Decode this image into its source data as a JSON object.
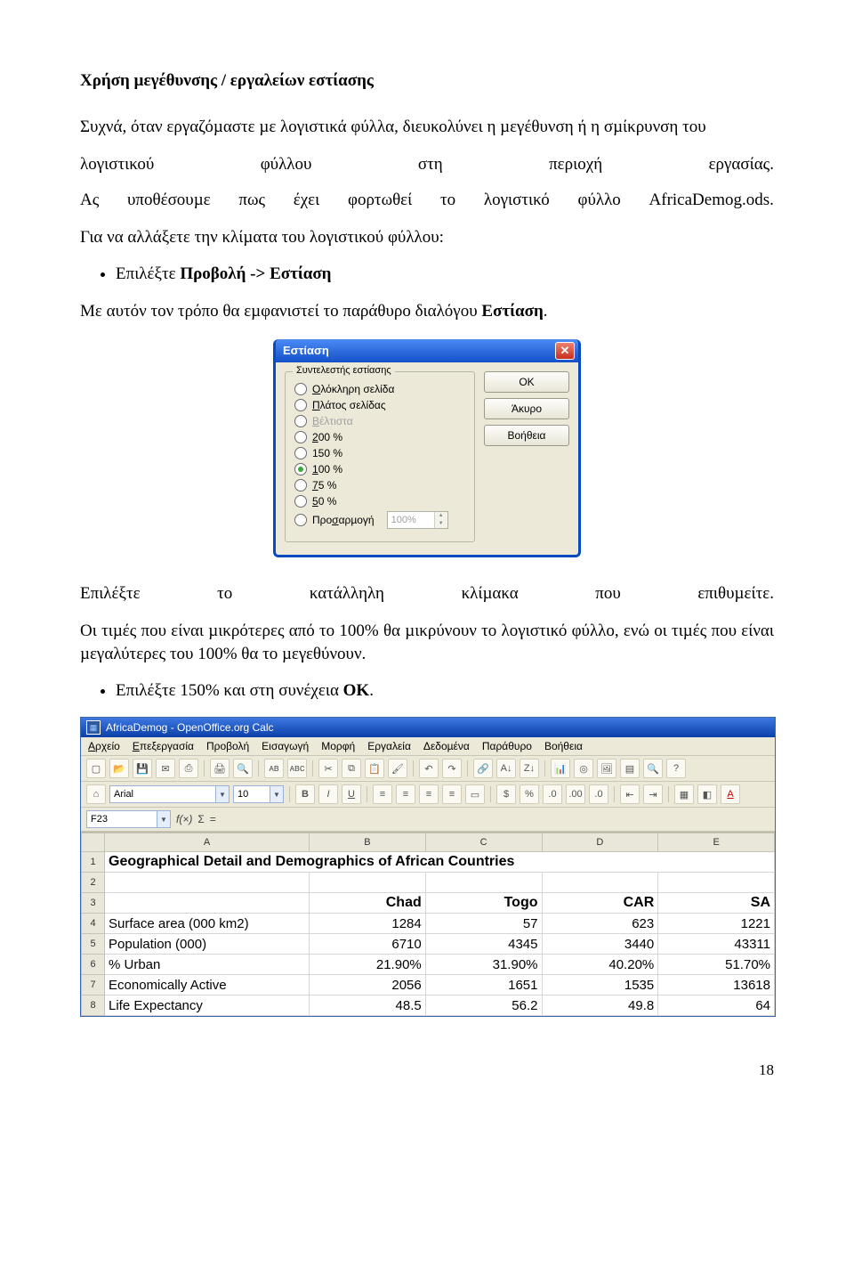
{
  "title": "Χρήση µεγέθυνσης / εργαλείων εστίασης",
  "p1": "Συχνά, όταν εργαζόµαστε µε λογιστικά φύλλα, διευκολύνει η µεγέθυνση ή η σµίκρυνση του",
  "row1": [
    "λογιστικού",
    "φύλλου",
    "στη",
    "περιοχή",
    "εργασίας."
  ],
  "row2": [
    "Ας",
    "υποθέσουµε",
    "πως",
    "έχει",
    "φορτωθεί",
    "το",
    "λογιστικό",
    "φύλλο",
    "AfricaDemog.ods."
  ],
  "p2": "Για να αλλάξετε την κλίµατα του λογιστικού φύλλου:",
  "bul1a": "Επιλέξτε ",
  "bul1b": "Προβολή -> Εστίαση",
  "p3a": "Με αυτόν τον τρόπο θα εµφανιστεί το παράθυρο διαλόγου ",
  "p3b": "Εστίαση",
  "p3c": ".",
  "dlg": {
    "title": "Εστίαση",
    "close": "✕",
    "group": "Συντελεστής εστίασης",
    "opts": {
      "o1": "λόκληρη σελίδα",
      "o1u": "Ο",
      "o2": "λάτος σελίδας",
      "o2u": "Π",
      "o3": "έλτιστα",
      "o3u": "Β",
      "o4": "00 %",
      "o4u": "2",
      "o5": "150 %",
      "o6": "00 %",
      "o6u": "1",
      "o7": "5 %",
      "o7u": "7",
      "o8": "0 %",
      "o8u": "5",
      "o9": "Προ",
      "o9u": "σ",
      "o9b": "αρµογή"
    },
    "spin": "100%",
    "btnOK": "OK",
    "btnCancel": "Άκυρο",
    "btnHelp": "Βοήθεια"
  },
  "row3": [
    "Επιλέξτε",
    "το",
    "κατάλληλη",
    "κλίµακα",
    "που",
    "επιθυµείτε."
  ],
  "p4": "Οι τιµές που είναι µικρότερες από το 100% θα µικρύνουν το λογιστικό φύλλο, ενώ οι τιµές που είναι µεγαλύτερες του 100% θα το µεγεθύνουν.",
  "bul2a": "Επιλέξτε 150% και στη συνέχεια ",
  "bul2b": "ΟΚ",
  "bul2c": ".",
  "calc": {
    "title": "AfricaDemog - OpenOffice.org Calc",
    "menu": [
      "Αρχείο",
      "Επεξεργασία",
      "Προβολή",
      "Εισαγωγή",
      "Μορφή",
      "Εργαλεία",
      "Δεδοµένα",
      "Παράθυρο",
      "Βοήθεια"
    ],
    "font": "Arial",
    "size": "10",
    "cell": "F23",
    "cols": [
      "",
      "A",
      "B",
      "C",
      "D",
      "E"
    ],
    "rowNums": [
      "1",
      "2",
      "3",
      "4",
      "5",
      "6",
      "7",
      "8"
    ],
    "titlecell": "Geographical Detail and Demographics of African Countries",
    "hdr": [
      "",
      "Chad",
      "Togo",
      "CAR",
      "SA"
    ],
    "r4": [
      "Surface area (000 km2)",
      "1284",
      "57",
      "623",
      "1221"
    ],
    "r5": [
      "Population (000)",
      "6710",
      "4345",
      "3440",
      "43311"
    ],
    "r6": [
      "% Urban",
      "21.90%",
      "31.90%",
      "40.20%",
      "51.70%"
    ],
    "r7": [
      "Economically Active",
      "2056",
      "1651",
      "1535",
      "13618"
    ],
    "r8": [
      "Life Expectancy",
      "48.5",
      "56.2",
      "49.8",
      "64"
    ]
  },
  "pageNum": "18"
}
